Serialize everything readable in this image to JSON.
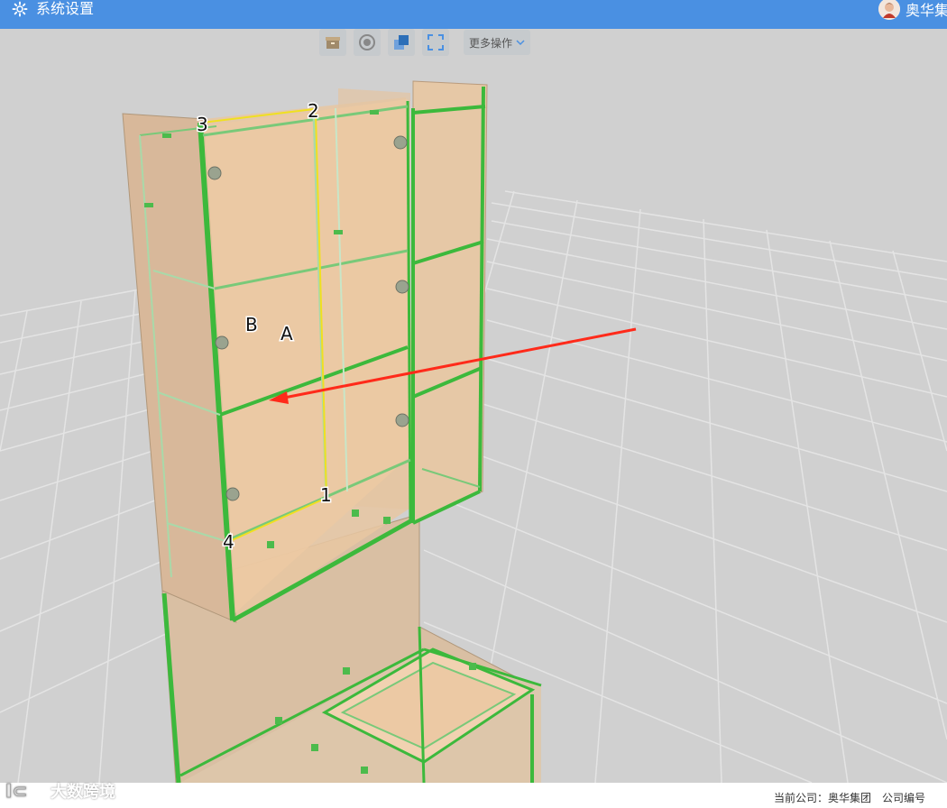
{
  "header": {
    "title": "系统设置",
    "user_company": "奥华集团"
  },
  "toolbar": {
    "more_label": "更多操作"
  },
  "scene": {
    "labels": {
      "p1": "1",
      "p2": "2",
      "p3": "3",
      "p4": "4",
      "a": "A",
      "b": "B"
    },
    "arrow_color": "#ff2a1a",
    "edge_highlight_color": "#f0e020",
    "panel_edge_color": "#3cb93c"
  },
  "status": {
    "current_company": "当前公司：奥华集团",
    "company_code": "公司编号"
  },
  "watermark": {
    "text": "大数跨境"
  }
}
